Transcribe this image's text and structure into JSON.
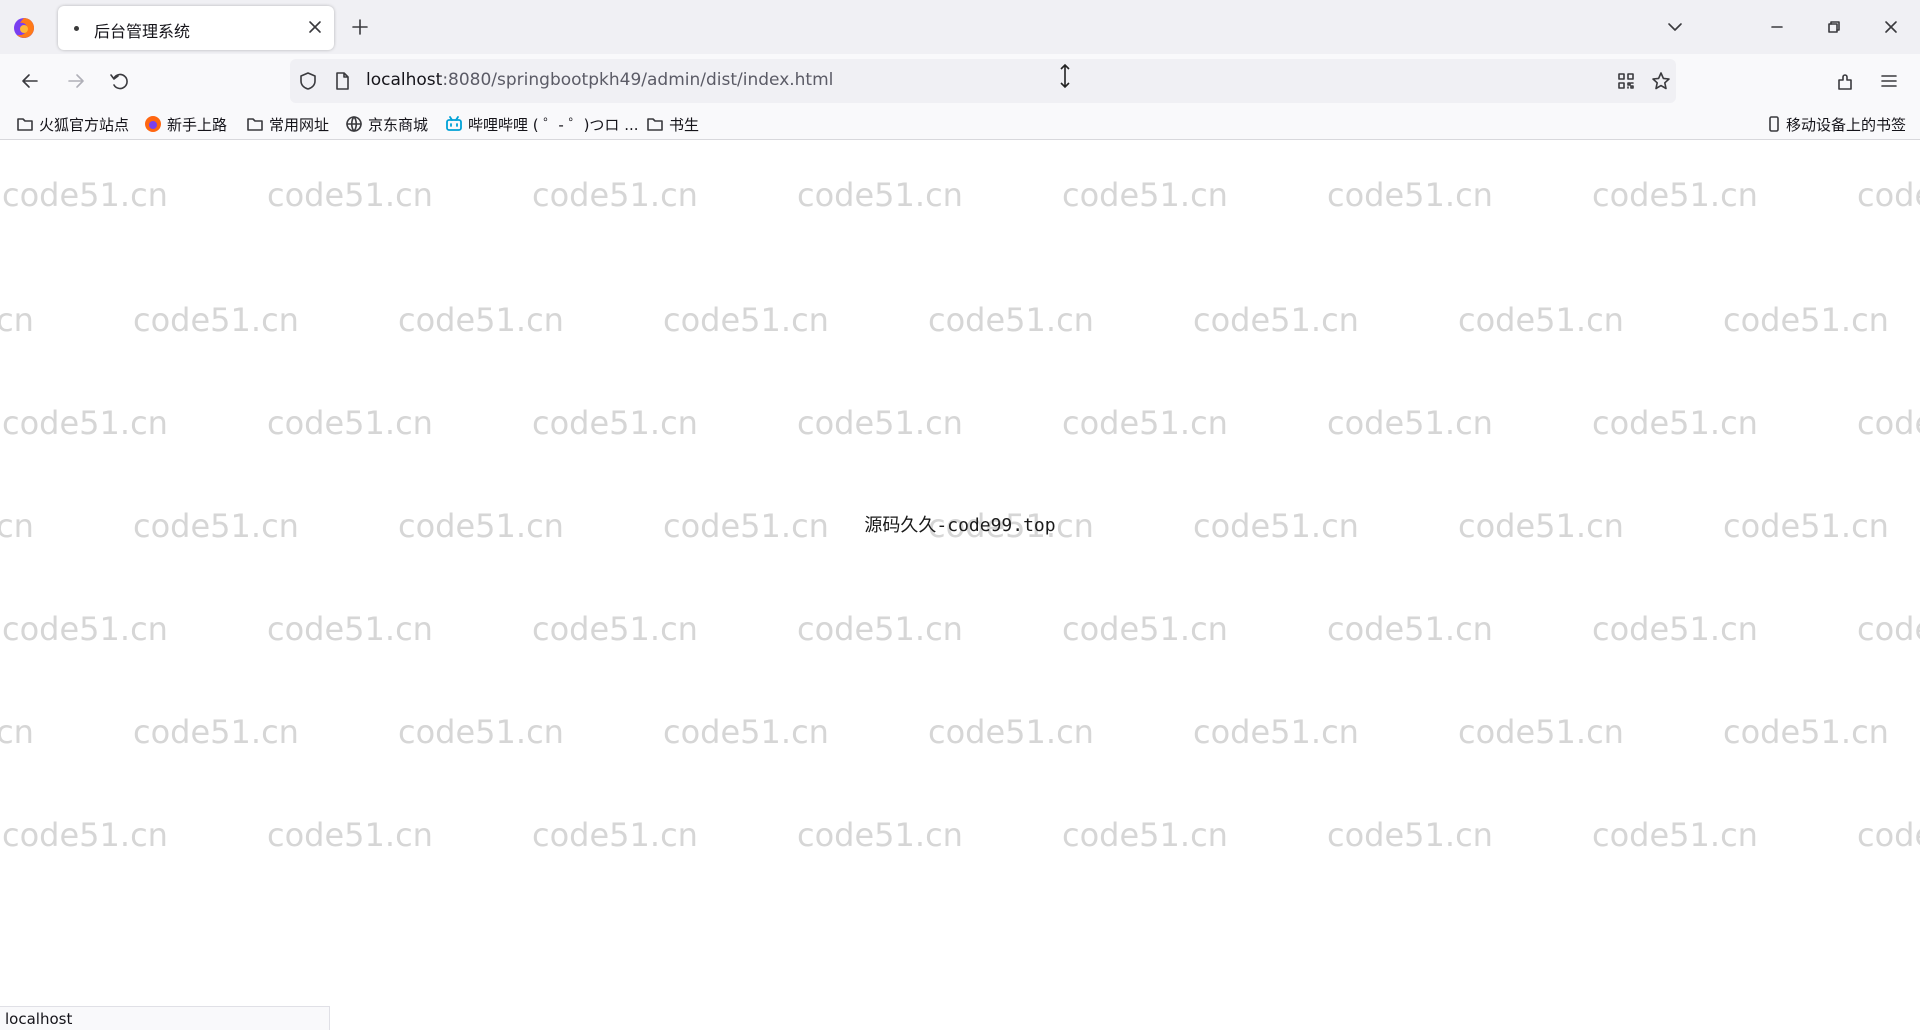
{
  "browser": {
    "tab": {
      "title": "后台管理系统"
    },
    "url": {
      "host": "localhost",
      "rest": ":8080/springbootpkh49/admin/dist/index.html"
    },
    "bookmarks": [
      {
        "label": "火狐官方站点",
        "icon": "folder-icon"
      },
      {
        "label": "新手上路",
        "icon": "firefox-icon"
      },
      {
        "label": "常用网址",
        "icon": "folder-icon"
      },
      {
        "label": "京东商城",
        "icon": "globe-icon"
      },
      {
        "label": "哔哩哔哩 ( ゜- ゜)つロ ...",
        "icon": "bilibili-icon"
      },
      {
        "label": "书生",
        "icon": "folder-icon"
      }
    ],
    "mobile_bookmarks": "移动设备上的书签",
    "status_text": "localhost"
  },
  "page": {
    "watermark_text": "code51.cn",
    "center_text": "源码久久-code99.top"
  }
}
